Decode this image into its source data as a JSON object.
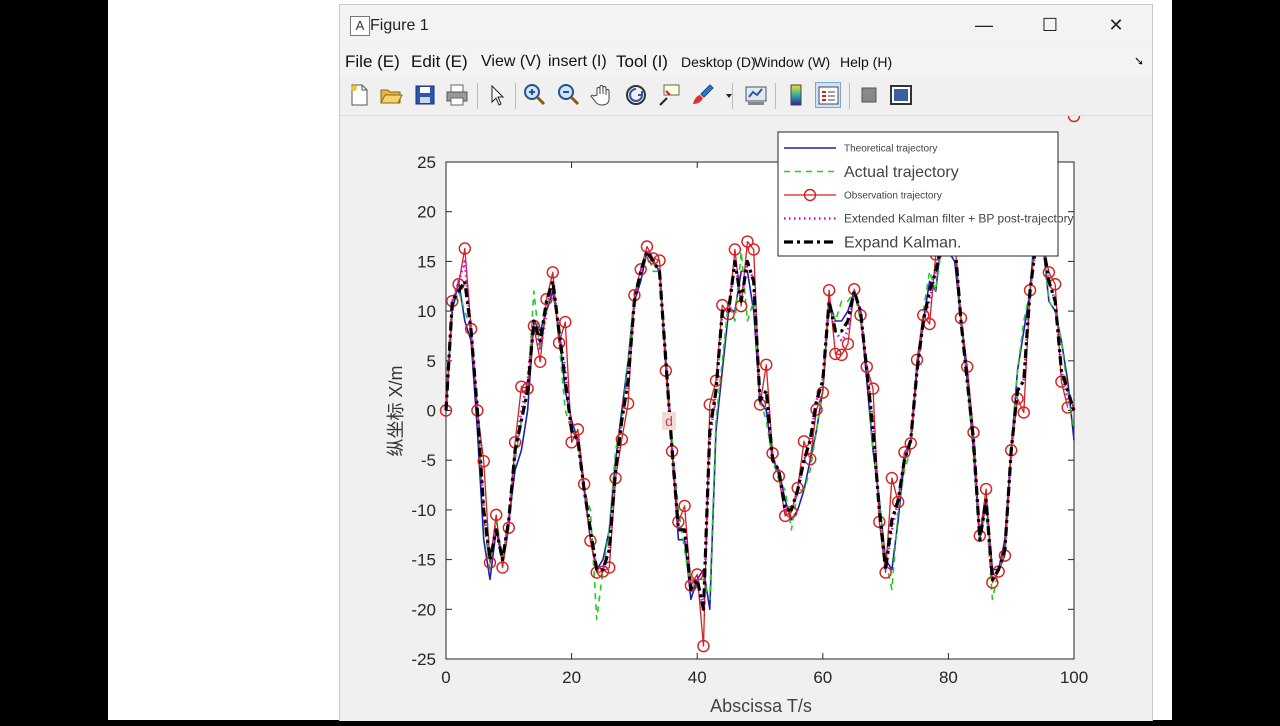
{
  "window": {
    "title": "Figure 1",
    "app_icon": "A",
    "controls": {
      "minimize": "—",
      "maximize": "☐",
      "close": "✕"
    }
  },
  "menu": [
    {
      "label": "File (E)",
      "size": "lg"
    },
    {
      "label": "Edit (E)",
      "size": "lg"
    },
    {
      "label": "View (V)",
      "size": "md"
    },
    {
      "label": "insert (I)",
      "size": "md"
    },
    {
      "label": "Tool (I)",
      "size": "lg"
    },
    {
      "label": "Desktop (D)",
      "size": "sm"
    },
    {
      "label": "Window (W)",
      "size": "sm"
    },
    {
      "label": "Help (H)",
      "size": "sm"
    }
  ],
  "toolbar": [
    "new-figure-icon",
    "open-file-icon",
    "save-icon",
    "print-icon",
    "select-arrow-icon",
    "zoom-in-icon",
    "zoom-out-icon",
    "pan-hand-icon",
    "rotate-3d-icon",
    "data-cursor-icon",
    "brush-icon",
    "link-plot-icon",
    "colorbar-icon",
    "legend-icon",
    "hide-plot-tools-icon",
    "show-plot-tools-icon"
  ],
  "stray_label": "d",
  "chart_data": {
    "type": "line",
    "xlabel": "Abscissa T/s",
    "ylabel": "纵坐标 X/m",
    "xlim": [
      0,
      100
    ],
    "ylim": [
      -25,
      25
    ],
    "xticks": [
      "0",
      "20",
      "40",
      "60",
      "80",
      "100"
    ],
    "yticks": [
      "25",
      "20",
      "15",
      "10",
      "5",
      "0",
      "-5",
      "-10",
      "-15",
      "-20",
      "-25"
    ],
    "grid": false,
    "legend_position": "top-right",
    "x": [
      0,
      1,
      2,
      3,
      4,
      5,
      6,
      7,
      8,
      9,
      10,
      11,
      12,
      13,
      14,
      15,
      16,
      17,
      18,
      19,
      20,
      21,
      22,
      23,
      24,
      25,
      26,
      27,
      28,
      29,
      30,
      31,
      32,
      33,
      34,
      35,
      36,
      37,
      38,
      39,
      40,
      41,
      42,
      43,
      44,
      45,
      46,
      47,
      48,
      49,
      50,
      51,
      52,
      53,
      54,
      55,
      56,
      57,
      58,
      59,
      60,
      61,
      62,
      63,
      64,
      65,
      66,
      67,
      68,
      69,
      70,
      71,
      72,
      73,
      74,
      75,
      76,
      77,
      78,
      79,
      80,
      81,
      82,
      83,
      84,
      85,
      86,
      87,
      88,
      89,
      90,
      91,
      92,
      93,
      94,
      95,
      96,
      97,
      98,
      99,
      100
    ],
    "series": [
      {
        "name": "Theoretical trajectory",
        "color": "#1f1fb4",
        "style": "solid",
        "values": [
          0,
          10,
          13,
          9,
          7,
          -2,
          -13,
          -17,
          -12,
          -15,
          -11,
          -6,
          -4,
          0,
          9,
          8,
          10,
          12,
          8,
          2,
          -1,
          -3,
          -8,
          -13,
          -16,
          -15,
          -12,
          -5,
          0,
          5,
          11,
          13,
          16,
          15,
          14,
          5,
          -4,
          -13,
          -13,
          -19,
          -17,
          -16,
          -20,
          -2,
          4,
          10,
          10,
          14,
          14,
          10,
          1,
          0,
          -5,
          -6,
          -9,
          -11,
          -10,
          -8,
          -5,
          -2,
          2,
          11,
          9,
          9,
          10,
          12,
          10,
          3,
          -4,
          -9,
          -15,
          -16,
          -11,
          -5,
          -3,
          4,
          9,
          13,
          12,
          18,
          16,
          15,
          9,
          3,
          -4,
          -13,
          -9,
          -16,
          -16,
          -13,
          -4,
          4,
          8,
          12,
          20,
          17,
          11,
          10,
          7,
          3,
          -3
        ]
      },
      {
        "name": "Actual trajectory",
        "color": "#22cc22",
        "style": "dashed",
        "values": [
          0,
          10,
          12,
          10,
          8,
          0,
          -11,
          -16,
          -11,
          -15,
          -11,
          -5,
          -1,
          2,
          12,
          6,
          10,
          13,
          7,
          0,
          -2,
          -3,
          -8,
          -10,
          -21,
          -16,
          -12,
          -4,
          -1,
          5,
          12,
          14,
          16,
          14,
          14,
          6,
          -3,
          -10,
          -14,
          -18,
          -17,
          -17,
          -19,
          -1,
          5,
          11,
          9,
          16,
          9,
          11,
          1,
          -1,
          -5,
          -7,
          -8,
          -12,
          -8,
          -8,
          -6,
          -2,
          2,
          11,
          9,
          11,
          11,
          12,
          9,
          5,
          -4,
          -9,
          -15,
          -18,
          -10,
          -6,
          -4,
          4,
          10,
          14,
          12,
          17,
          16,
          17,
          9,
          3,
          -5,
          -13,
          -10,
          -19,
          -16,
          -14,
          -5,
          4,
          9,
          12,
          21,
          17,
          11,
          10,
          7,
          2,
          -2
        ]
      },
      {
        "name": "Observation trajectory",
        "color": "#d42020",
        "style": "markers",
        "values": [
          0,
          11,
          12.7,
          16.3,
          8.2,
          0,
          -5.1,
          -15.3,
          -10.5,
          -15.8,
          -11.8,
          -3.2,
          2.4,
          2.2,
          8.5,
          4.9,
          11.2,
          13.9,
          6.8,
          8.9,
          -3.2,
          -1.9,
          -7.4,
          -13.1,
          -16.3,
          -16.2,
          -15.8,
          -6.8,
          -2.9,
          0.7,
          11.6,
          14.2,
          16.5,
          15.3,
          15.1,
          4,
          -4.1,
          -11.2,
          -9.6,
          -17.6,
          -16.5,
          -23.7,
          0.6,
          3,
          10.6,
          9.7,
          16.2,
          10.5,
          17,
          16.2,
          0.6,
          4.6,
          -4.3,
          -6.6,
          -10.6,
          -10.2,
          -7.8,
          -3.1,
          -4.9,
          0.1,
          1.8,
          12.1,
          5.7,
          5.6,
          6.7,
          12.2,
          9.6,
          4.4,
          2.2,
          -11.2,
          -16.3,
          -6.8,
          -9.2,
          -4.2,
          -3.3,
          5.1,
          9.6,
          8.7,
          15.7,
          17.1,
          16.3,
          17.2,
          9.3,
          4.4,
          -2.2,
          -12.6,
          -7.9,
          -17.3,
          -16.2,
          -14.6,
          -4,
          1.2,
          -0.2,
          12.1,
          17.5,
          17.1,
          13.9,
          12.7,
          2.9,
          0.3
        ]
      },
      {
        "name": "Extended Kalman filter + BP post-trajectory",
        "color": "#e000e0",
        "style": "dotted",
        "values": [
          0,
          11,
          13,
          15,
          8,
          0,
          -10,
          -15,
          -12,
          -15,
          -11,
          -4,
          0,
          3,
          9,
          6,
          10,
          13,
          8,
          4,
          -2,
          -3,
          -8,
          -12,
          -16,
          -16,
          -14,
          -6,
          -1,
          3,
          11,
          14,
          16,
          15,
          14,
          5,
          -4,
          -12,
          -12,
          -18,
          -17,
          -20,
          -3,
          2,
          10,
          10,
          15,
          11,
          15,
          13,
          1,
          2,
          -5,
          -6,
          -10,
          -10,
          -8,
          -5,
          -3,
          1,
          3,
          11,
          8,
          7,
          8,
          12,
          10,
          4,
          -1,
          -10,
          -16,
          -12,
          -9,
          -5,
          -3,
          4,
          9,
          11,
          14,
          17,
          16,
          17,
          9,
          4,
          -3,
          -13,
          -9,
          -17,
          -16,
          -14,
          -4,
          2,
          3,
          12,
          17,
          17,
          13,
          11,
          4,
          1,
          0
        ]
      },
      {
        "name": "Expand Kalman.",
        "color": "#000000",
        "style": "dashdot",
        "values": [
          0,
          11,
          12,
          13,
          8,
          0,
          -10,
          -15,
          -12,
          -15,
          -11,
          -4,
          -1,
          2,
          9,
          7,
          11,
          13,
          8,
          3,
          -2,
          -3,
          -8,
          -12,
          -16,
          -16,
          -14,
          -6,
          -1,
          3,
          11,
          14,
          16,
          15,
          14,
          5,
          -4,
          -12,
          -12,
          -18,
          -17,
          -20,
          -2,
          2,
          10,
          10,
          15,
          11,
          15,
          13,
          1,
          2,
          -5,
          -6,
          -10,
          -10,
          -8,
          -5,
          -3,
          1,
          3,
          11,
          8,
          8,
          9,
          12,
          10,
          4,
          -2,
          -10,
          -16,
          -11,
          -9,
          -5,
          -3,
          4,
          9,
          12,
          14,
          17,
          16,
          17,
          9,
          3,
          -3,
          -13,
          -9,
          -17,
          -16,
          -14,
          -4,
          2,
          3,
          12,
          17,
          17,
          13,
          11,
          4,
          2,
          0
        ]
      }
    ]
  }
}
